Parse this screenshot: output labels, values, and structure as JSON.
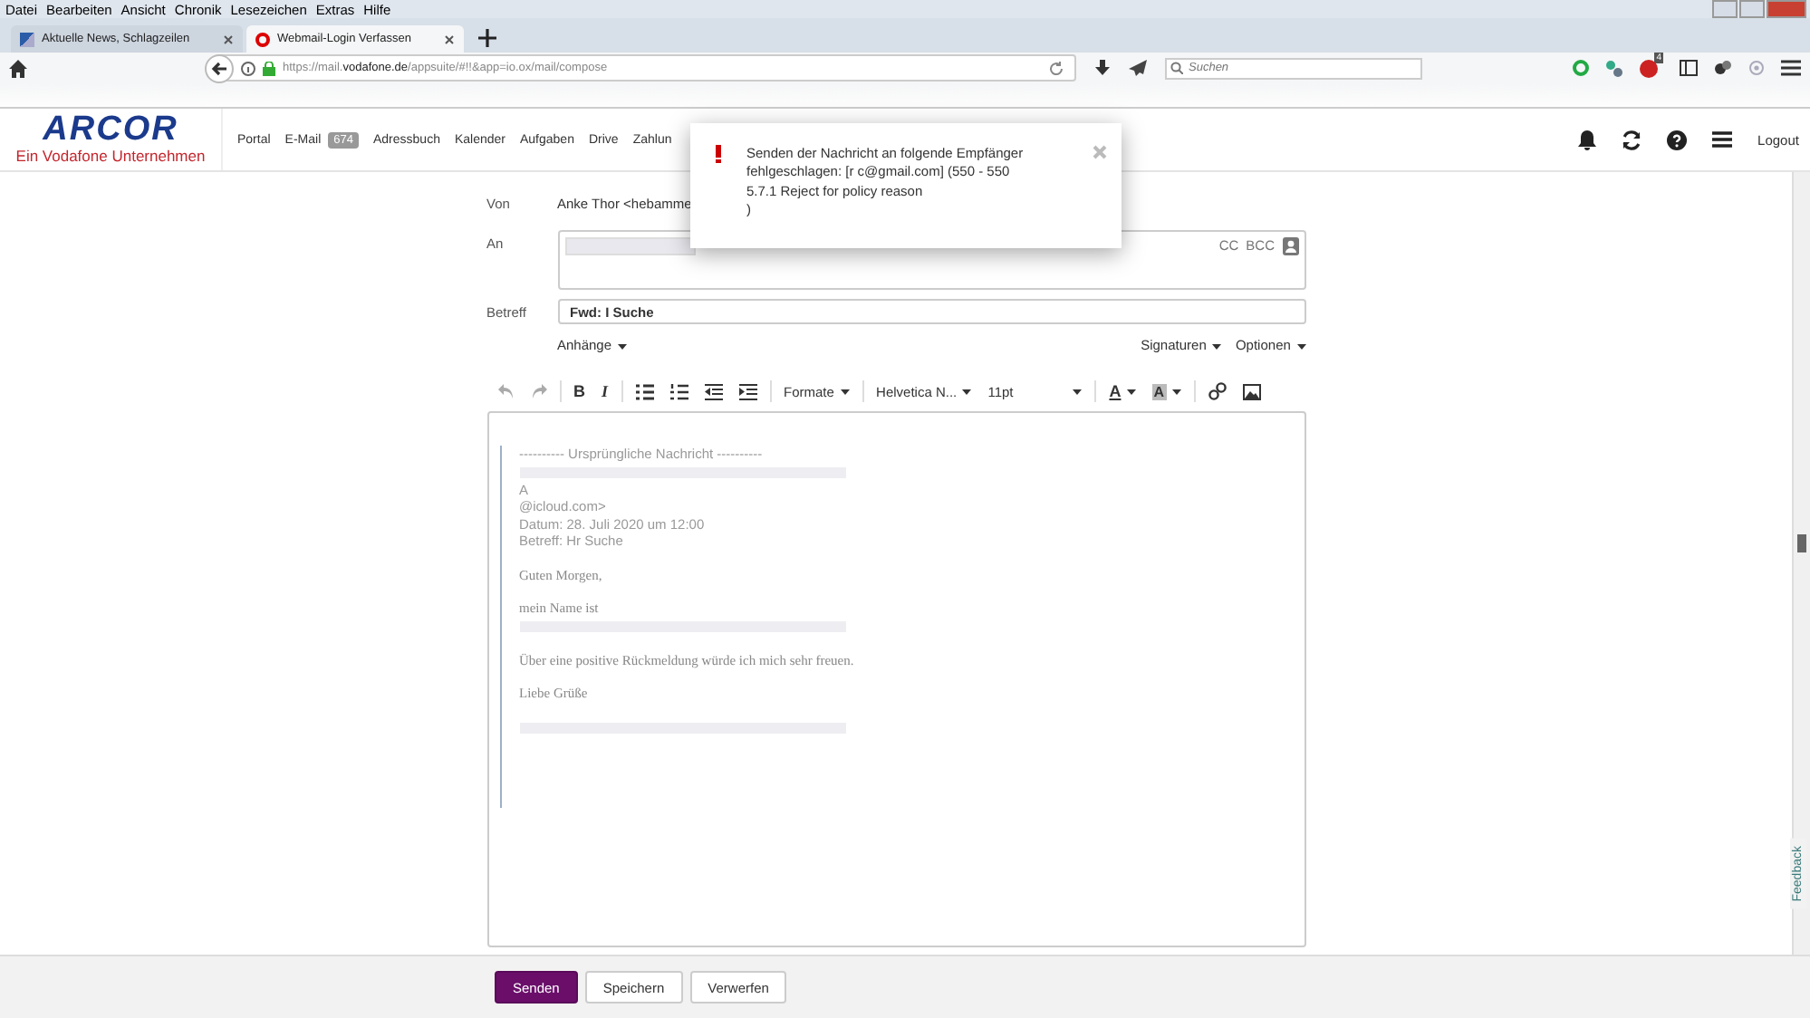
{
  "browser": {
    "menu": [
      "Datei",
      "Bearbeiten",
      "Ansicht",
      "Chronik",
      "Lesezeichen",
      "Extras",
      "Hilfe"
    ],
    "tabs": [
      {
        "title": "Aktuelle News, Schlagzeilen",
        "selected": false
      },
      {
        "title": "Webmail-Login Verfassen",
        "selected": true
      }
    ],
    "url": {
      "scheme": "https://mail.",
      "domain": "vodafone.de",
      "path": "/appsuite/#!!&app=io.ox/mail/compose"
    },
    "search": {
      "placeholder": "Suchen"
    },
    "addon_badge": "4"
  },
  "app": {
    "logo": "ARCOR",
    "tagline": "Ein Vodafone Unternehmen",
    "nav": [
      {
        "label": "Portal"
      },
      {
        "label": "E-Mail",
        "count": "674"
      },
      {
        "label": "Adressbuch"
      },
      {
        "label": "Kalender"
      },
      {
        "label": "Aufgaben"
      },
      {
        "label": "Drive"
      },
      {
        "label": "Zahlun"
      }
    ],
    "logout": "Logout"
  },
  "compose": {
    "from_label": "Von",
    "from": "Anke Thor <hebamme",
    "to_label": "An",
    "cc": "CC",
    "bcc": "BCC",
    "subject_label": "Betreff",
    "subject": "Fwd: I Suche",
    "attachments": "Anhänge",
    "signatures": "Signaturen",
    "options": "Optionen",
    "bold": "B",
    "italic": "I",
    "text_color": "A",
    "highlight": "A",
    "formats": "Formate",
    "font": "Helvetica N...",
    "size": "11pt",
    "body": [
      {
        "kind": "header",
        "text": "---------- Ursprüngliche Nachricht ----------"
      },
      {
        "kind": "redacted"
      },
      {
        "kind": "header",
        "text": "A"
      },
      {
        "kind": "header",
        "text": "@icloud.com>"
      },
      {
        "kind": "header",
        "text": "Datum: 28. Juli 2020 um 12:00"
      },
      {
        "kind": "header",
        "text": "Betreff: Hr Suche"
      },
      {
        "kind": "gap"
      },
      {
        "kind": "text",
        "text": "Guten Morgen,"
      },
      {
        "kind": "gap"
      },
      {
        "kind": "text",
        "text": "mein Name ist"
      },
      {
        "kind": "redacted"
      },
      {
        "kind": "gap"
      },
      {
        "kind": "text",
        "text": "Über eine positive Rückmeldung würde ich mich sehr freuen."
      },
      {
        "kind": "gap"
      },
      {
        "kind": "text",
        "text": "Liebe Grüße"
      },
      {
        "kind": "gap"
      },
      {
        "kind": "redacted"
      }
    ],
    "buttons": [
      {
        "label": "Senden",
        "primary": true
      },
      {
        "label": "Speichern",
        "primary": false
      },
      {
        "label": "Verwerfen",
        "primary": false
      }
    ]
  },
  "toast": {
    "lines": [
      "Senden der Nachricht an folgende Empfänger",
      "fehlgeschlagen: [r c@gmail.com] (550 - 550",
      "5.7.1 Reject for policy reason",
      ")"
    ]
  },
  "feedback": "Feedback"
}
